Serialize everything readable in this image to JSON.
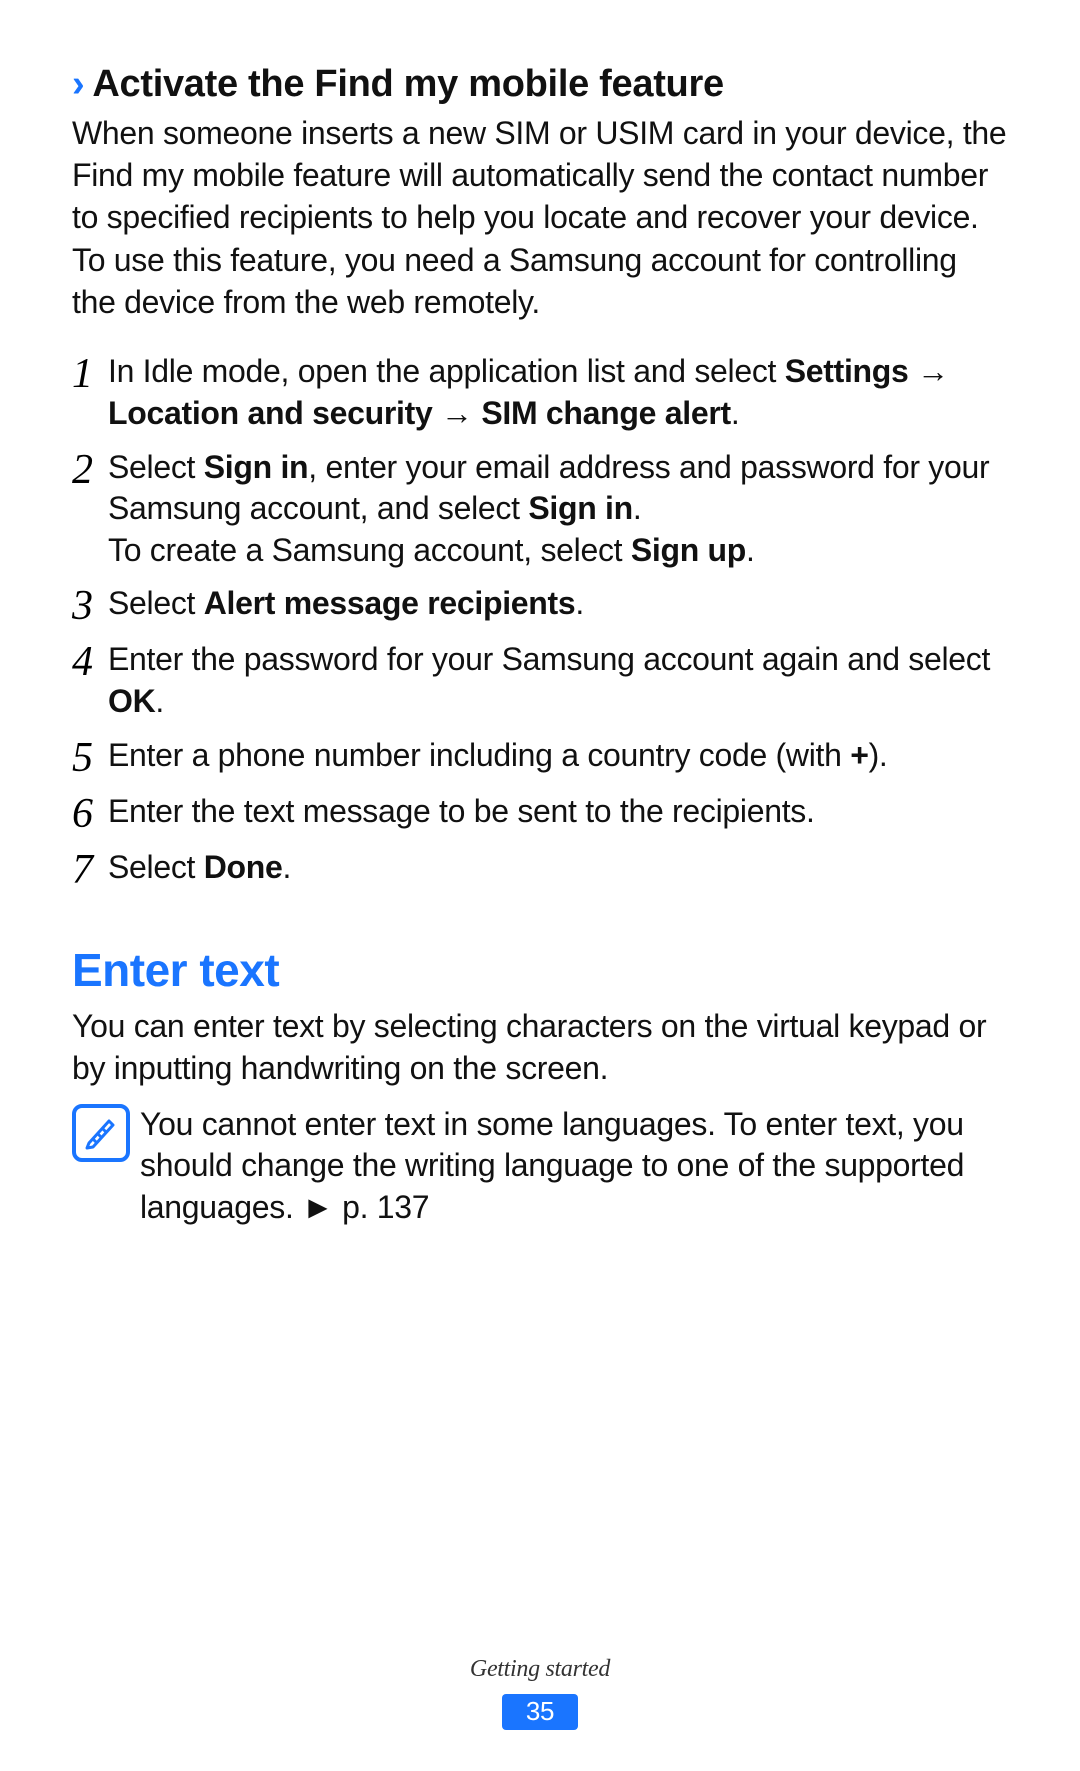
{
  "subsection": {
    "chevron": "›",
    "title": "Activate the Find my mobile feature",
    "intro1": "When someone inserts a new SIM or USIM card in your device, the Find my mobile feature will automatically send the contact number to specified recipients to help you locate and recover your device.",
    "intro2": "To use this feature, you need a Samsung account for controlling the device from the web remotely."
  },
  "steps": {
    "s1": {
      "num": "1",
      "pre": "In Idle mode, open the application list and select ",
      "b1": "Settings",
      "arrow1": " → ",
      "b2": "Location and security",
      "arrow2": " → ",
      "b3": "SIM change alert",
      "end": "."
    },
    "s2": {
      "num": "2",
      "a1": "Select ",
      "b1": "Sign in",
      "a2": ", enter your email address and password for your Samsung account, and select ",
      "b2": "Sign in",
      "a3": ".",
      "line2a": "To create a Samsung account, select ",
      "line2b": "Sign up",
      "line2c": "."
    },
    "s3": {
      "num": "3",
      "a1": "Select ",
      "b1": "Alert message recipients",
      "a2": "."
    },
    "s4": {
      "num": "4",
      "a1": "Enter the password for your Samsung account again and select ",
      "b1": "OK",
      "a2": "."
    },
    "s5": {
      "num": "5",
      "a1": "Enter a phone number including a country code (with ",
      "b1": "+",
      "a2": ")."
    },
    "s6": {
      "num": "6",
      "text": "Enter the text message to be sent to the recipients."
    },
    "s7": {
      "num": "7",
      "a1": "Select ",
      "b1": "Done",
      "a2": "."
    }
  },
  "section2": {
    "title": "Enter text",
    "intro": "You can enter text by selecting characters on the virtual keypad or by inputting handwriting on the screen.",
    "note": "You cannot enter text in some languages. To enter text, you should change the writing language to one of the supported languages. ► p. 137"
  },
  "footer": {
    "section": "Getting started",
    "page": "35"
  }
}
